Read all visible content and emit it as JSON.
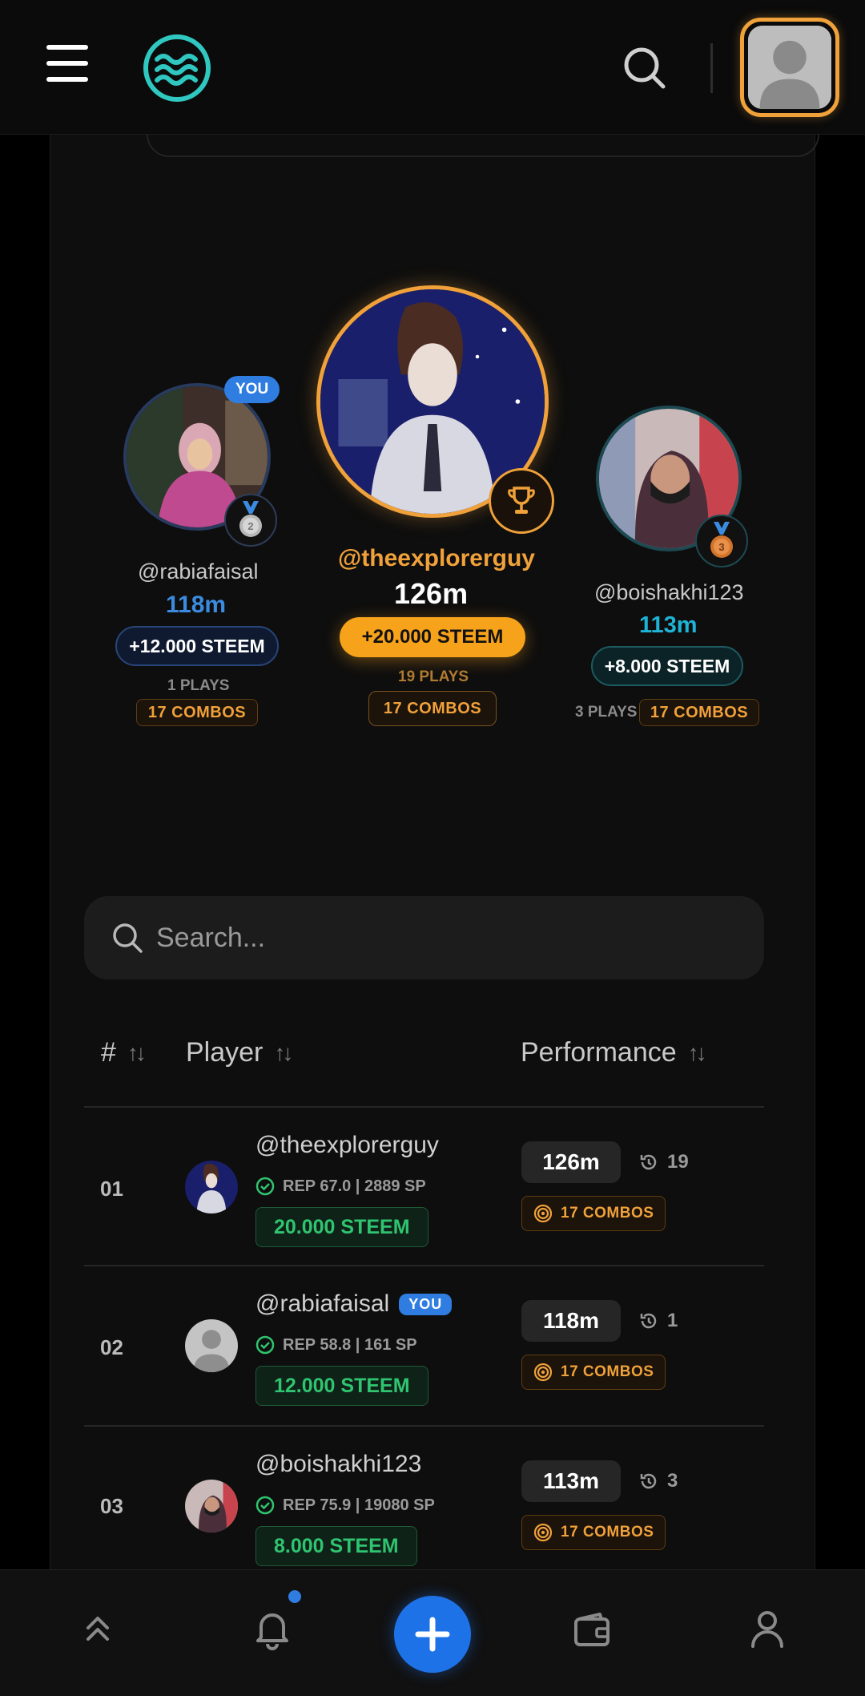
{
  "header": {
    "menu_icon": "hamburger-menu-icon",
    "logo_icon": "waves-logo-icon",
    "search_icon": "search-icon",
    "profile_icon": "user-avatar-icon"
  },
  "podium": {
    "first": {
      "name": "@theexplorerguy",
      "score": "126m",
      "reward": "+20.000 STEEM",
      "plays": "19 PLAYS",
      "combos": "17 COMBOS",
      "badge_icon": "trophy-icon"
    },
    "second": {
      "name": "@rabiafaisal",
      "score": "118m",
      "reward": "+12.000 STEEM",
      "plays": "1 PLAYS",
      "combos": "17 COMBOS",
      "you": "YOU",
      "badge_icon": "silver-medal-icon"
    },
    "third": {
      "name": "@boishakhi123",
      "score": "113m",
      "reward": "+8.000 STEEM",
      "plays": "3 PLAYS",
      "combos": "17 COMBOS",
      "badge_icon": "bronze-medal-icon"
    }
  },
  "search": {
    "placeholder": "Search..."
  },
  "table": {
    "headers": {
      "rank": "#",
      "player": "Player",
      "performance": "Performance"
    },
    "rows": [
      {
        "rank": "01",
        "name": "@theexplorerguy",
        "rep": "REP 67.0 | 2889 SP",
        "reward": "20.000 STEEM",
        "score": "126m",
        "plays": "19",
        "combos": "17 COMBOS",
        "you": ""
      },
      {
        "rank": "02",
        "name": "@rabiafaisal",
        "rep": "REP 58.8 | 161 SP",
        "reward": "12.000 STEEM",
        "score": "118m",
        "plays": "1",
        "combos": "17 COMBOS",
        "you": "YOU"
      },
      {
        "rank": "03",
        "name": "@boishakhi123",
        "rep": "REP 75.9 | 19080 SP",
        "reward": "8.000 STEEM",
        "score": "113m",
        "plays": "3",
        "combos": "17 COMBOS",
        "you": ""
      }
    ]
  },
  "bottom_nav": {
    "items": [
      "chevrons-up-icon",
      "bell-icon",
      "plus-icon",
      "wallet-icon",
      "user-icon"
    ]
  },
  "colors": {
    "accent_orange": "#f0a13a",
    "accent_blue": "#2f7de1",
    "steem_green": "#2fc46f",
    "teal_score": "#1fb3d6"
  }
}
